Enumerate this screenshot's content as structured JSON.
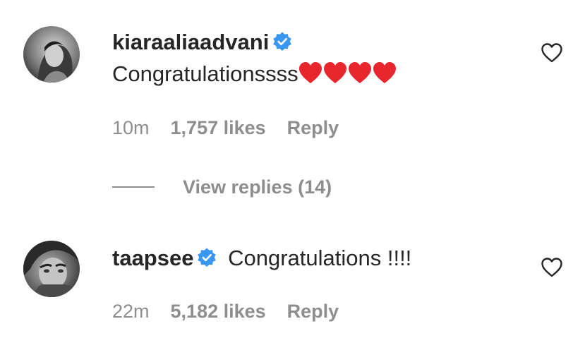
{
  "comments": [
    {
      "username": "kiaraaliaadvani",
      "verified": true,
      "text": "Congratulationssss",
      "emoji": "❤️❤️❤️❤️",
      "time": "10m",
      "likes": "1,757 likes",
      "reply": "Reply",
      "view_replies": "View replies (14)"
    },
    {
      "username": "taapsee",
      "verified": true,
      "text": "Congratulations !!!!",
      "time": "22m",
      "likes": "5,182 likes",
      "reply": "Reply"
    }
  ],
  "colors": {
    "text": "#262626",
    "meta": "#8e8e8e",
    "verified": "#3897f0",
    "heart_emoji": "#e8262d"
  },
  "icons": {
    "verified": "verified-badge-icon",
    "like": "heart-outline-icon",
    "emoji": "red-heart-emoji"
  }
}
